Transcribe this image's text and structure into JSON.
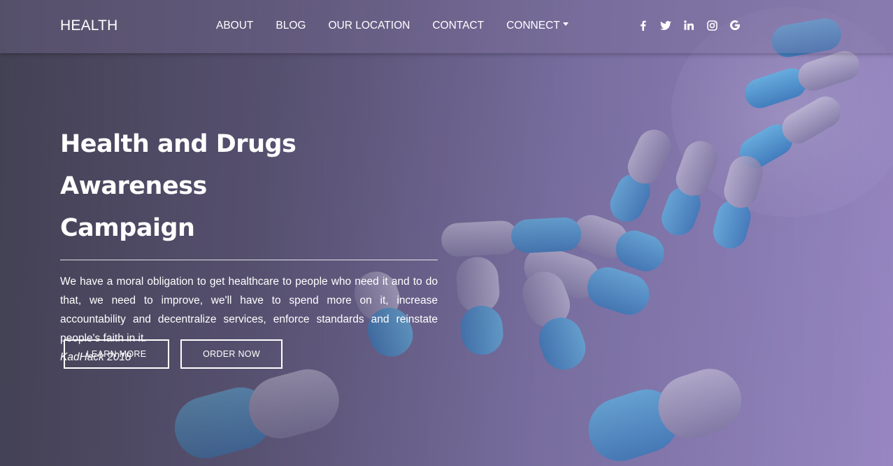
{
  "navbar": {
    "brand": "HEALTH",
    "links": [
      "ABOUT",
      "BLOG",
      "OUR LOCATION",
      "CONTACT",
      "CONNECT"
    ],
    "social_icons": [
      "facebook-icon",
      "twitter-icon",
      "linkedin-icon",
      "instagram-icon",
      "google-icon"
    ]
  },
  "hero": {
    "title_line1": "Health and Drugs Awareness",
    "title_line2": "Campaign",
    "description": "We have a moral obligation to get healthcare to people who need it and to do that, we need to improve, we'll have to spend more on it, increase accountability and decentralize services, enforce standards and reinstate people's faith in it.",
    "signature": "KadHack 2018",
    "learn_more_label": "LEARN MORE",
    "order_now_label": "ORDER NOW"
  },
  "colors": {
    "text": "#ffffff",
    "pill_blue": "#3aa0e0",
    "pill_grey": "#9c97b8",
    "overlay": "#6e6592"
  }
}
